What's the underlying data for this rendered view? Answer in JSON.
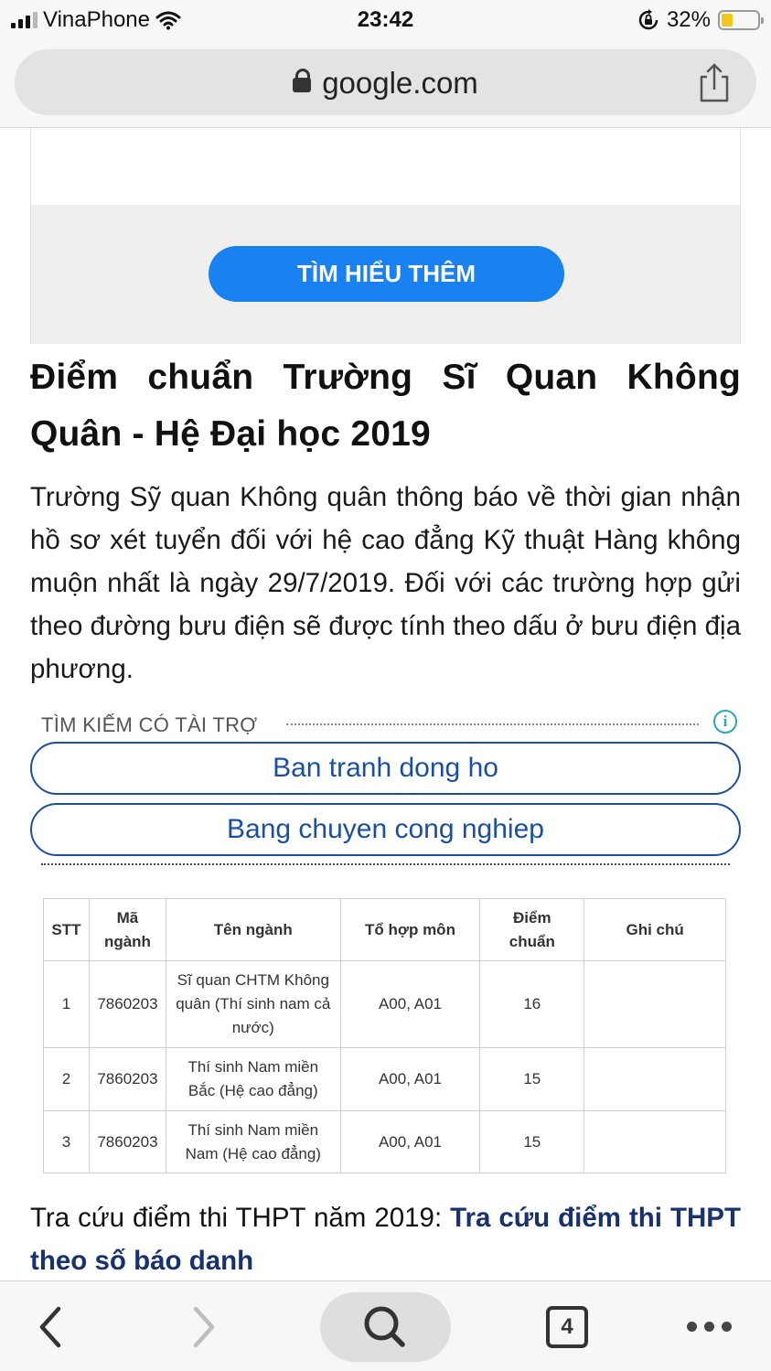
{
  "status": {
    "carrier": "VinaPhone",
    "time": "23:42",
    "battery": "32%",
    "battery_level": 0.32
  },
  "browser": {
    "url": "google.com"
  },
  "ad": {
    "cta_label": "TÌM HIỂU THÊM"
  },
  "article": {
    "title": "Điểm chuẩn Trường Sĩ Quan Không Quân - Hệ Đại học 2019",
    "paragraph": "Trường Sỹ quan Không quân thông báo về thời gian nhận hồ sơ xét tuyển đối với hệ cao đẳng Kỹ thuật Hàng không muộn nhất là ngày 29/7/2019. Đối với các trường hợp gửi theo đường bưu điện sẽ được tính theo dấu ở bưu điện địa phương."
  },
  "sponsored": {
    "heading": "TÌM KIẾM CÓ TÀI TRỢ",
    "links": [
      "Ban tranh dong ho",
      "Bang chuyen cong nghiep"
    ]
  },
  "table": {
    "headers": [
      "STT",
      "Mã ngành",
      "Tên ngành",
      "Tổ hợp môn",
      "Điểm chuẩn",
      "Ghi chú"
    ],
    "rows": [
      [
        "1",
        "7860203",
        "Sĩ quan CHTM Không quân (Thí sinh nam cả nước)",
        "A00, A01",
        "16",
        ""
      ],
      [
        "2",
        "7860203",
        "Thí sinh Nam miền Bắc (Hệ cao đẳng)",
        "A00, A01",
        "15",
        ""
      ],
      [
        "3",
        "7860203",
        "Thí sinh Nam miền Nam (Hệ cao đẳng)",
        "A00, A01",
        "15",
        ""
      ]
    ]
  },
  "lookup": {
    "prefix": "Tra cứu điểm thi THPT năm 2019: ",
    "link": "Tra cứu điểm thi THPT theo số báo danh"
  },
  "toolbar": {
    "tab_count": "4"
  },
  "colors": {
    "cta": "#1a82f0",
    "sponsored_link": "#1a4fa5",
    "article_link": "#17326e",
    "battery": "#f5c518"
  }
}
